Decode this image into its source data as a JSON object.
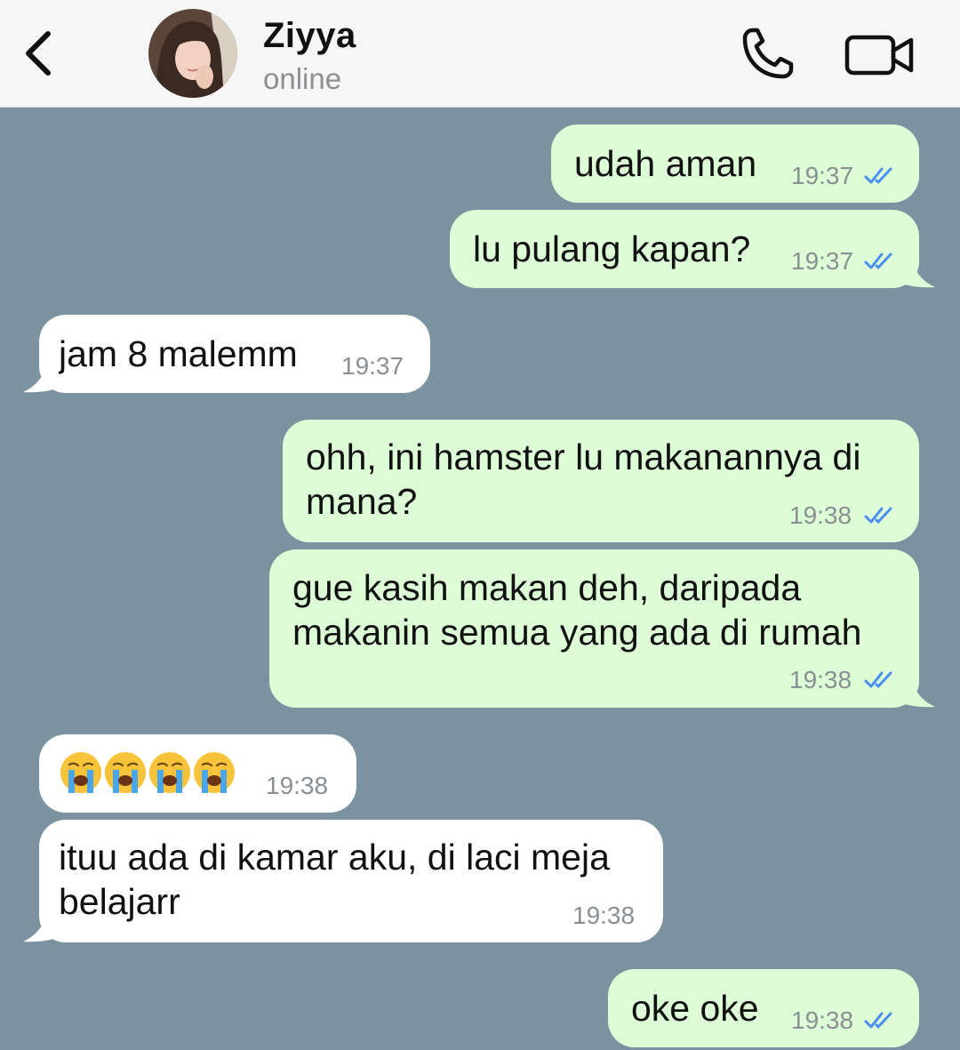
{
  "header": {
    "contact_name": "Ziyya",
    "status": "online",
    "icons": {
      "back": "chevron-left-icon",
      "call": "phone-icon",
      "video": "video-camera-icon"
    }
  },
  "colors": {
    "chat_background": "#7b93a0",
    "outgoing_bubble": "#dcfdd6",
    "incoming_bubble": "#ffffff",
    "read_ticks": "#4a8ff0",
    "timestamp": "#8a8f94"
  },
  "messages": [
    {
      "direction": "outgoing",
      "text": "udah aman",
      "time": "19:37",
      "read": true
    },
    {
      "direction": "outgoing",
      "text": "lu pulang kapan?",
      "time": "19:37",
      "read": true
    },
    {
      "direction": "incoming",
      "text": "jam 8 malemm",
      "time": "19:37"
    },
    {
      "direction": "outgoing",
      "text": "ohh, ini hamster lu makanannya di\nmana?",
      "time": "19:38",
      "read": true
    },
    {
      "direction": "outgoing",
      "text": "gue kasih makan deh, daripada\nmakanin semua yang ada di rumah",
      "time": "19:38",
      "read": true
    },
    {
      "direction": "incoming",
      "text": "😭😭😭😭",
      "time": "19:38"
    },
    {
      "direction": "incoming",
      "text": "ituu ada di kamar aku, di laci meja\nbelajarr",
      "time": "19:38"
    },
    {
      "direction": "outgoing",
      "text": "oke oke",
      "time": "19:38",
      "read": true
    }
  ]
}
